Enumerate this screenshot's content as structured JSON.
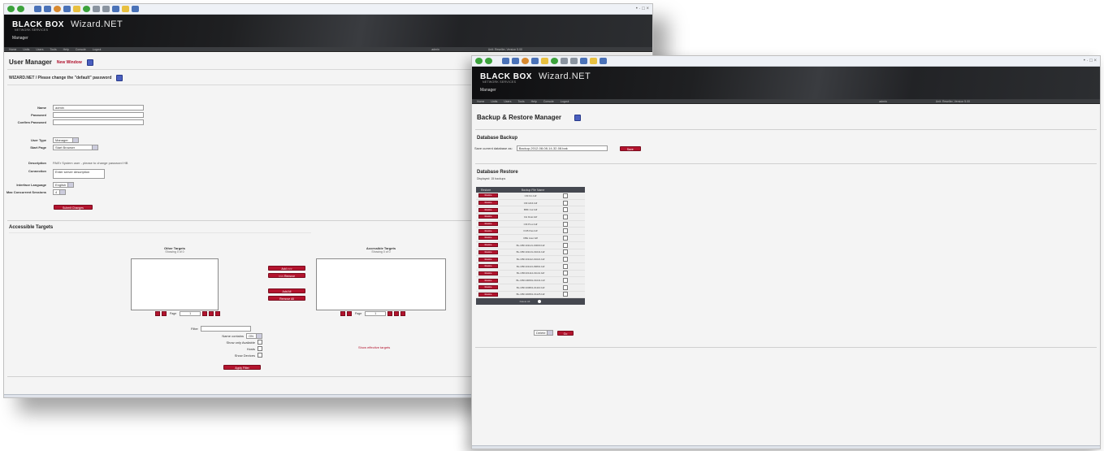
{
  "left_window": {
    "browser_corner": "• · □ ×",
    "logo": {
      "brand": "BLACK BOX",
      "product": "Wizard.NET",
      "tagline": "NETWORK SERVICES",
      "role": "Manager"
    },
    "nav": [
      "Home",
      "Units",
      "Users",
      "Tools",
      "Help",
      "Console",
      "Logout"
    ],
    "nav_status": [
      "admin",
      "Unit: Reseller, Version 5.00"
    ],
    "title": "User Manager",
    "title_link": "New Window",
    "subtitle": "WIZARD.NET / Please change the \"default\" password",
    "form": {
      "fields": [
        {
          "label": "Name",
          "value": "admin"
        },
        {
          "label": "Password",
          "value": ""
        },
        {
          "label": "Confirm Password",
          "value": ""
        }
      ],
      "user_type_label": "User Type",
      "user_type_value": "Manager",
      "start_page_label": "Start Page",
      "start_page_value": "Start Browser",
      "description_label": "Description",
      "description_value": "PA/Er System user - please to change password HB",
      "connection_label": "Connection",
      "connection_value": "Enter server description",
      "interface_lang_label": "Interface Language",
      "interface_lang_value": "English",
      "max_sessions_label": "Max Concurrent Sessions",
      "max_sessions_value": "4",
      "submit_label": "Submit Changes"
    },
    "targets": {
      "section_title": "Accessible Targets",
      "other_title": "Other Targets",
      "other_sub": "Showing 0 of 0",
      "access_title": "Accessible Targets",
      "access_sub": "Showing 0 of 0",
      "buttons": [
        "Add >>>",
        "<<< Remove",
        "Add All",
        "Remove All"
      ],
      "page_label": "Page",
      "page_value": "1",
      "filter_label": "Filter",
      "filter_options": [
        {
          "label": "Name contains",
          "value": "ON"
        },
        {
          "label": "Show only Available",
          "value": ""
        },
        {
          "label": "Hosts",
          "value": ""
        },
        {
          "label": "Show Devices",
          "value": ""
        }
      ],
      "apply_label": "Apply Filter",
      "right_link": "Show effective targets"
    }
  },
  "right_window": {
    "browser_corner": "• · □ ×",
    "logo": {
      "brand": "BLACK BOX",
      "product": "Wizard.NET",
      "tagline": "NETWORK SERVICES",
      "role": "Manager"
    },
    "nav": [
      "Home",
      "Units",
      "Users",
      "Tools",
      "Help",
      "Console",
      "Logout"
    ],
    "nav_status": [
      "admin",
      "Unit: Reseller, Version 5.00"
    ],
    "title": "Backup & Restore Manager",
    "backup": {
      "title": "Database Backup",
      "label": "Save current database as:",
      "filename": "Backup-2012-08-08-14-32-08.bak",
      "button": "Save"
    },
    "restore": {
      "title": "Database Restore",
      "subtitle": "Displayed: 15 backups",
      "columns": [
        "Restore",
        "Backup File Name"
      ],
      "rows": [
        "CM Fin.bdf",
        "CM HD4.bdf",
        "BBK Cur.bdf",
        "CH Dcat.bdf",
        "CM Proc.bdf",
        "FCB Pas.bdf",
        "CBE Aout.bdf",
        "BL-CBF101121-00000.bdf",
        "BL-CBF101131-01041.bdf",
        "BL-CBF101112-01021.bdf",
        "BL-CBF101113-09801.bdf",
        "BL-CBF101114-01141.bdf",
        "BL-CBF100801-01041.bdf",
        "BL-CBF100801-01110.bdf",
        "BL-CBF100801-01125.bdf"
      ],
      "row_button": "Restore",
      "footer": "Delete All",
      "select_value": "Delete",
      "go_label": "Go"
    }
  }
}
